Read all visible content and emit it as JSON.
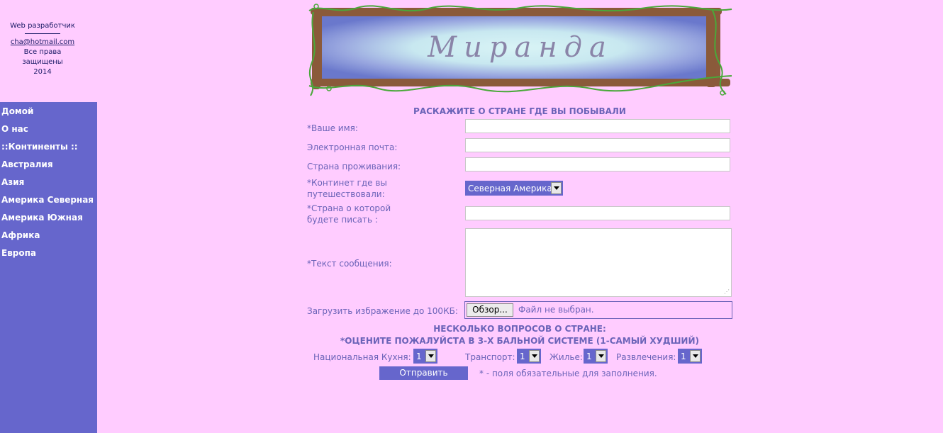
{
  "credits": {
    "role": "Web разработчик",
    "email": "cha@hotmail.com",
    "rights_line1": "Все права",
    "rights_line2": "защищены",
    "year": "2014"
  },
  "sidebar": {
    "items": [
      {
        "label": "Домой"
      },
      {
        "label": "О нас"
      },
      {
        "label": "::Континенты ::"
      },
      {
        "label": "Австралия"
      },
      {
        "label": "Азия"
      },
      {
        "label": "Америка Северная"
      },
      {
        "label": "Америка Южная"
      },
      {
        "label": "Африка"
      },
      {
        "label": "Европа"
      }
    ]
  },
  "banner": {
    "title": "Миранда"
  },
  "form": {
    "title": "РАСКАЖИТЕ О СТРАНЕ ГДЕ ВЫ ПОБЫВАЛИ",
    "name_label": "*Ваше имя:",
    "email_label": "Электронная почта:",
    "country_label": "Страна проживания:",
    "continent_label_line1": "*Континет где вы",
    "continent_label_line2": "путешествовали:",
    "continent_value": "Северная Америка",
    "write_country_label_line1": "*Страна о которой",
    "write_country_label_line2": "будете писать :",
    "message_label": "*Текст сообщения:",
    "upload_label": "Загрузить избражение до 100КБ:",
    "browse_button": "Обзор...",
    "file_status": "Файл не выбран."
  },
  "questions": {
    "heading1": "НЕСКОЛЬКО ВОПРОСОВ О СТРАНЕ:",
    "heading2": "*ОЦЕНИТЕ ПОЖАЛУЙСТА В 3-Х БАЛЬНОЙ СИСТЕМЕ (1-САМЫЙ ХУДШИЙ)",
    "cuisine_label": "Национальная Кухня:",
    "cuisine_value": "1",
    "transport_label": "Транспорт:",
    "transport_value": "1",
    "housing_label": "Жилье:",
    "housing_value": "1",
    "entertainment_label": "Развлечения:",
    "entertainment_value": "1"
  },
  "submit": {
    "label": "Отправить",
    "note": "*  - поля обязательные для заполнения."
  },
  "colors": {
    "background": "#ffccff",
    "sidebar": "#6666cc",
    "text": "#6b63b8"
  }
}
